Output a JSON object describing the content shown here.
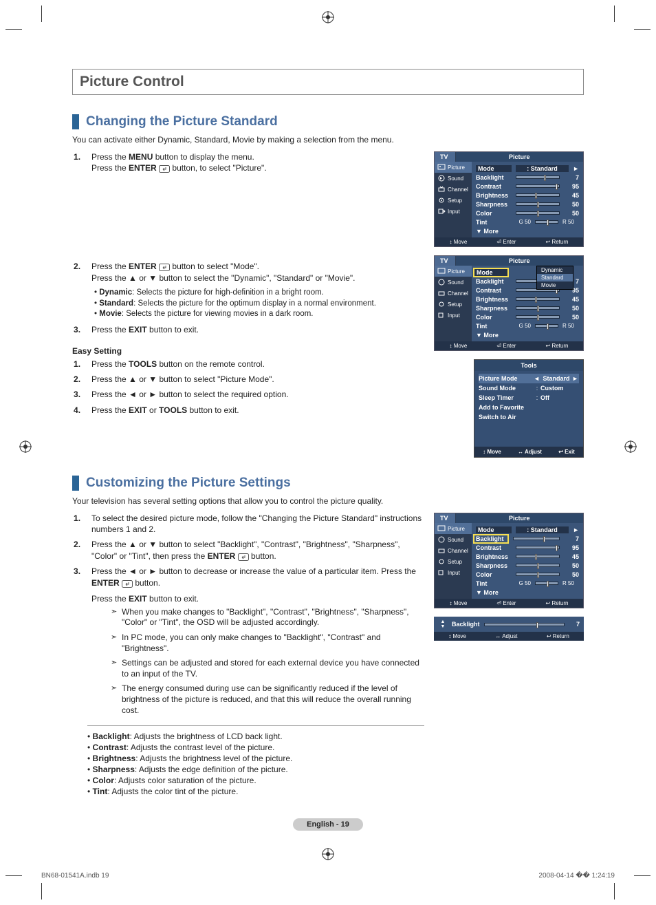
{
  "chapter_title": "Picture Control",
  "sec1": {
    "title": "Changing the Picture Standard",
    "intro": "You can activate either Dynamic, Standard, Movie by making a selection from the menu.",
    "step1a": "Press the ",
    "step1b": " button to display the menu.",
    "step1c": "Press the ",
    "step1d": " button, to select \"Picture\".",
    "menu_label": "MENU",
    "enter_label": "ENTER",
    "step2a": "Press the ",
    "step2b": " button to select \"Mode\".",
    "step2c": "Press the ▲ or ▼ button to select the \"Dynamic\", \"Standard\" or \"Movie\".",
    "bullets": {
      "b1a": "Dynamic",
      "b1b": ": Selects the picture for high-definition in a bright room.",
      "b2a": "Standard",
      "b2b": ": Selects the picture for the optimum display in a normal environment.",
      "b3a": "Movie",
      "b3b": ": Selects the picture for viewing movies in a dark room."
    },
    "step3a": "Press the ",
    "exit_label": "EXIT",
    "step3b": " button to exit.",
    "easy_heading": "Easy Setting",
    "easy": {
      "s1a": "Press the ",
      "tools_label": "TOOLS",
      "s1b": " button on the remote control.",
      "s2": "Press the ▲ or ▼ button to select \"Picture Mode\".",
      "s3": "Press the ◄ or ► button to select the required option.",
      "s4a": "Press the ",
      "s4b": " or ",
      "s4c": " button to exit."
    }
  },
  "sec2": {
    "title": "Customizing the Picture Settings",
    "intro": "Your television has several setting options that allow you to control the picture quality.",
    "s1": "To select the desired picture mode, follow the \"Changing the Picture Standard\" instructions numbers 1 and 2.",
    "s2a": "Press the ▲ or ▼ button to select \"Backlight\", \"Contrast\", \"Brightness\", \"Sharpness\", \"Color\" or \"Tint\", then press the ",
    "s2b": " button.",
    "s3a": "Press the ◄ or ► button to decrease or increase the value of a particular item. Press the ",
    "s3b": " button.",
    "s3c": "Press the ",
    "s3d": " button to exit.",
    "notes": {
      "n1": "When you make changes to \"Backlight\", \"Contrast\", \"Brightness\", \"Sharpness\", \"Color\" or \"Tint\", the OSD will be adjusted accordingly.",
      "n2": "In PC mode, you can only make changes to \"Backlight\", \"Contrast\" and \"Brightness\".",
      "n3": "Settings can be adjusted and stored for each external device you have connected to an input of the TV.",
      "n4": "The energy consumed during use can be significantly reduced if the level of brightness of the picture is reduced, and that this will reduce the overall running cost."
    },
    "defs": {
      "d1a": "Backlight",
      "d1b": ": Adjusts the brightness of LCD back light.",
      "d2a": "Contrast",
      "d2b": ": Adjusts the contrast level of the picture.",
      "d3a": "Brightness",
      "d3b": ": Adjusts the brightness level of the picture.",
      "d4a": "Sharpness",
      "d4b": ": Adjusts the edge definition of the picture.",
      "d5a": "Color",
      "d5b": ": Adjusts color saturation of the picture.",
      "d6a": "Tint",
      "d6b": ": Adjusts the color tint of the picture."
    }
  },
  "osd": {
    "tv_tab": "TV",
    "title": "Picture",
    "nav": {
      "picture": "Picture",
      "sound": "Sound",
      "channel": "Channel",
      "setup": "Setup",
      "input": "Input"
    },
    "rows": {
      "mode_lbl": "Mode",
      "mode_val": ": Standard",
      "backlight_lbl": "Backlight",
      "backlight_val": "7",
      "contrast_lbl": "Contrast",
      "contrast_val": "95",
      "brightness_lbl": "Brightness",
      "brightness_val": "45",
      "sharpness_lbl": "Sharpness",
      "sharpness_val": "50",
      "color_lbl": "Color",
      "color_val": "50",
      "tint_lbl": "Tint",
      "tint_g": "G 50",
      "tint_r": "R 50",
      "more_lbl": "▼ More"
    },
    "footer": {
      "move": "Move",
      "enter": "Enter",
      "return": "Return",
      "adjust": "Adjust",
      "exit": "Exit"
    },
    "dropdown": {
      "dynamic": "Dynamic",
      "standard": "Standard",
      "movie": "Movie"
    }
  },
  "tools": {
    "title": "Tools",
    "rows": {
      "pm_lbl": "Picture Mode",
      "pm_val": "Standard",
      "sm_lbl": "Sound Mode",
      "sm_val": "Custom",
      "st_lbl": "Sleep Timer",
      "st_val": "Off",
      "af_lbl": "Add to Favorite",
      "sa_lbl": "Switch to Air"
    }
  },
  "slider": {
    "label": "Backlight",
    "value": "7"
  },
  "page_label": "English - 19",
  "print_left": "BN68-01541A.indb   19",
  "print_right": "2008-04-14   �� 1:24:19",
  "icons": {
    "move": "↕",
    "enter": "⏎",
    "return": "↩",
    "adjust": "↔"
  }
}
